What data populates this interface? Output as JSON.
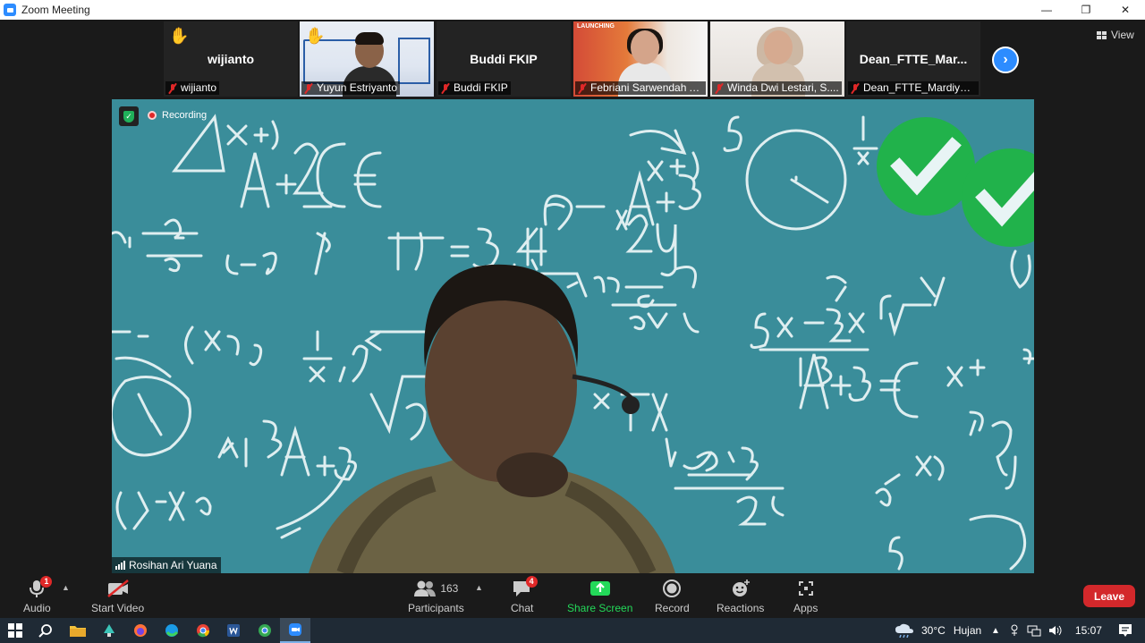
{
  "window": {
    "title": "Zoom Meeting",
    "minimize_glyph": "—",
    "restore_glyph": "❐",
    "close_glyph": "✕"
  },
  "participants_strip": [
    {
      "name": "wijianto",
      "display": "wijianto",
      "hand_raised": true,
      "video": false,
      "muted": true
    },
    {
      "name": "Yuyun Estriyanto",
      "hand_raised": true,
      "video": true,
      "muted": true
    },
    {
      "name": "Buddi FKIP",
      "display": "Buddi FKIP",
      "hand_raised": false,
      "video": false,
      "muted": true
    },
    {
      "name": "Febriani Sarwendah A...",
      "banner": "LAUNCHING",
      "hand_raised": false,
      "video": true,
      "muted": true
    },
    {
      "name": "Winda Dwi Lestari, S....",
      "hand_raised": false,
      "video": true,
      "muted": true
    },
    {
      "name": "Dean_FTTE_Mardiyana",
      "display": "Dean_FTTE_Mar...",
      "hand_raised": false,
      "video": false,
      "muted": true
    }
  ],
  "view_label": "View",
  "next_page_glyph": "›",
  "main_video": {
    "speaker": "Rosihan Ari Yuana",
    "recording_label": "Recording",
    "shield_glyph": "✓",
    "background_colors": {
      "teal": "#3a8d9a",
      "chalk": "#e8f4f5",
      "check": "#21b24b"
    }
  },
  "toolbar": {
    "audio": {
      "label": "Audio",
      "badge": "1"
    },
    "video": {
      "label": "Start Video"
    },
    "participants": {
      "label": "Participants",
      "count": "163"
    },
    "chat": {
      "label": "Chat",
      "badge": "4"
    },
    "share": {
      "label": "Share Screen",
      "accent": "#23d959"
    },
    "record": {
      "label": "Record"
    },
    "reactions": {
      "label": "Reactions"
    },
    "apps": {
      "label": "Apps"
    },
    "leave": {
      "label": "Leave",
      "color": "#d3282b"
    }
  },
  "taskbar": {
    "weather": {
      "temp": "30°C",
      "condition": "Hujan"
    },
    "clock": "15:07"
  }
}
